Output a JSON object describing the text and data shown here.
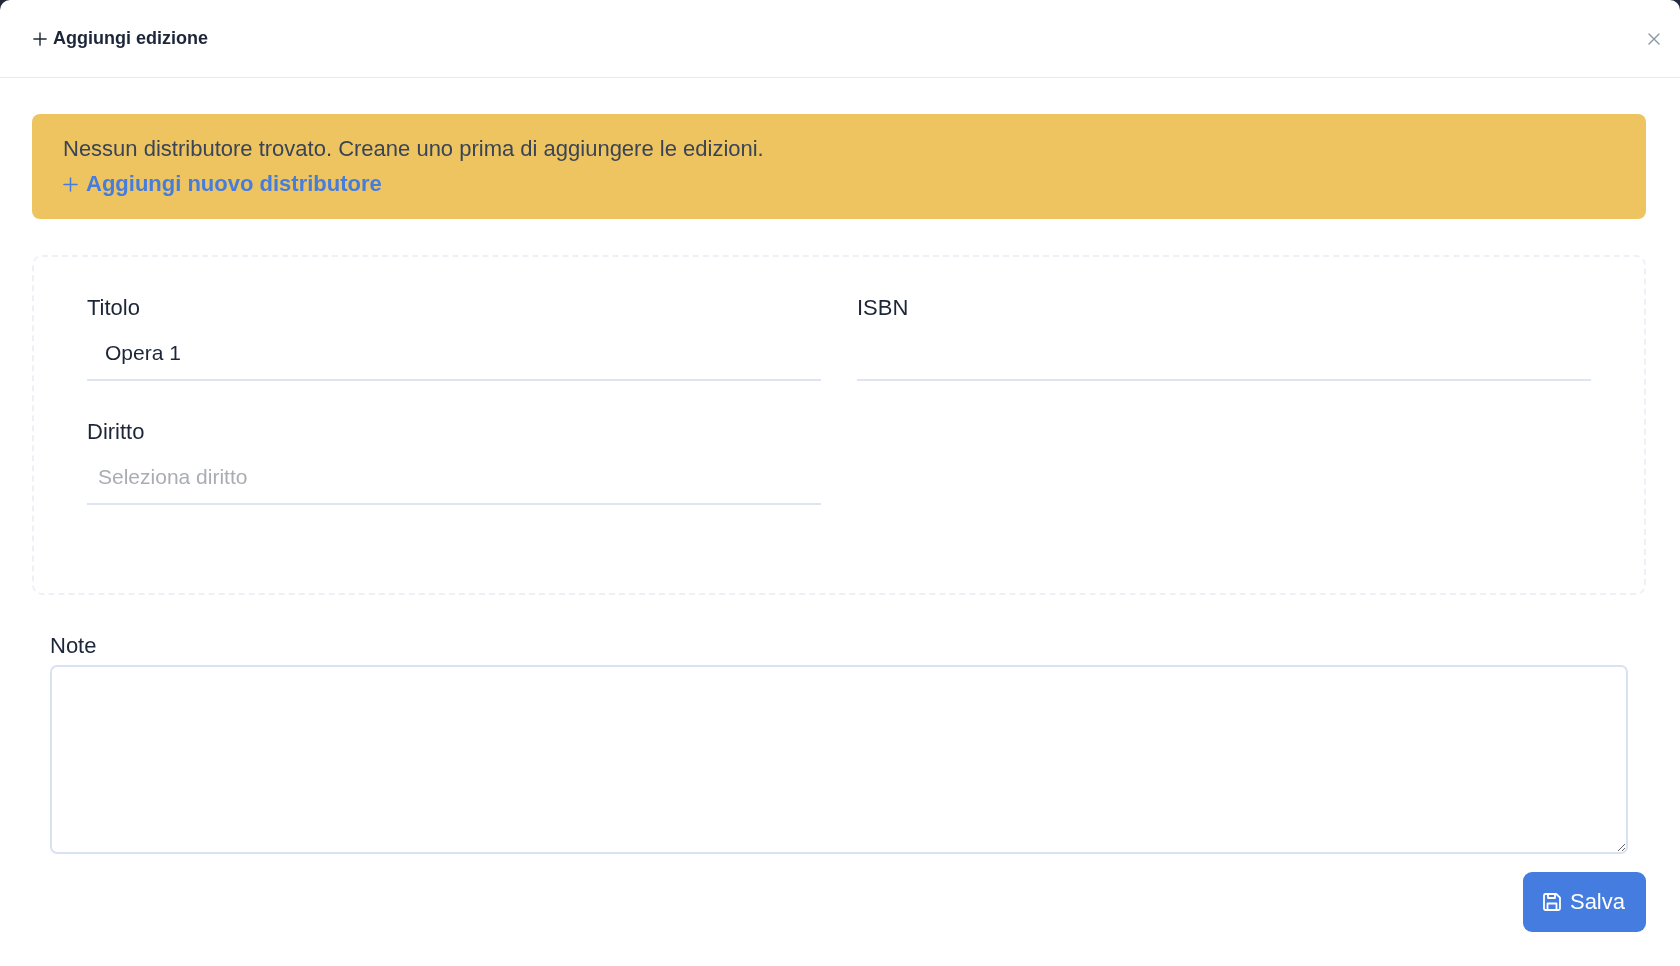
{
  "dialog": {
    "title": "Aggiungi edizione"
  },
  "alert": {
    "message": "Nessun distributore trovato. Creane uno prima di aggiungere le edizioni.",
    "link": "Aggiungi nuovo distributore"
  },
  "fields": [
    {
      "kind": "text",
      "label": "Titolo",
      "value": "Opera 1"
    },
    {
      "kind": "text",
      "label": "ISBN"
    },
    {
      "kind": "select",
      "label": "Diritto",
      "placeholder": "Seleziona diritto"
    }
  ],
  "notes": {
    "label": "Note"
  },
  "buttons": [
    {
      "kind": "save",
      "label": "Salva"
    }
  ]
}
